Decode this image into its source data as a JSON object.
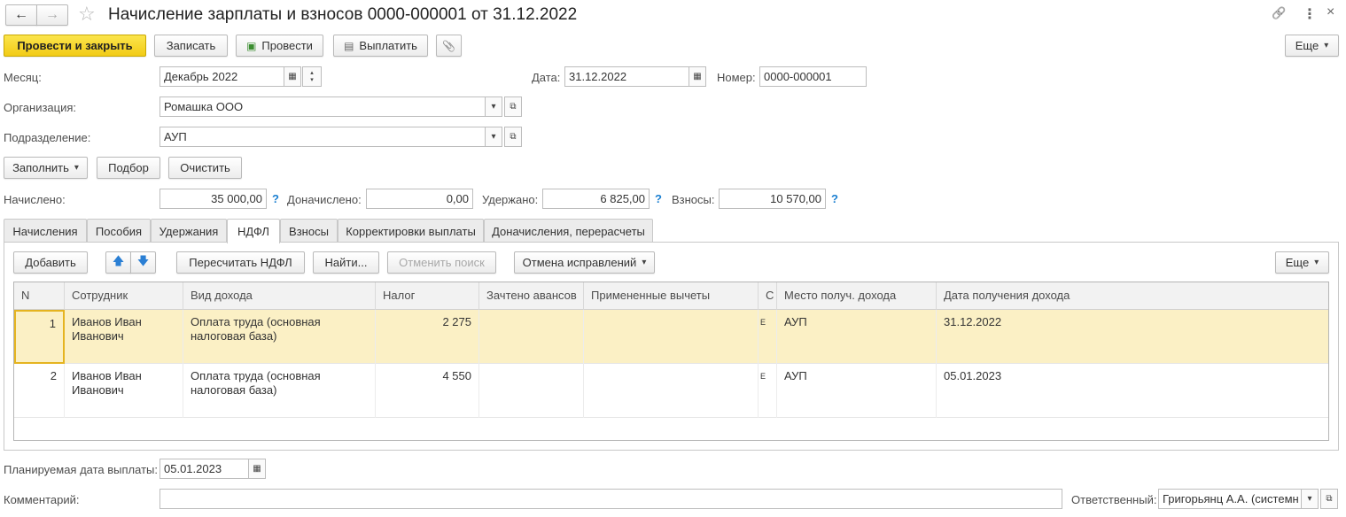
{
  "window": {
    "title": "Начисление зарплаты и взносов 0000-000001 от 31.12.2022",
    "nav_back": "←",
    "nav_forward": "→",
    "star": "☆",
    "link_icon": "🔗",
    "menu_icon": "⋮",
    "close_icon": "×"
  },
  "toolbar": {
    "post_close": "Провести и закрыть",
    "save": "Записать",
    "post": "Провести",
    "pay": "Выплатить",
    "attach_icon": "📎",
    "more": "Еще"
  },
  "header": {
    "month_label": "Месяц:",
    "month_value": "Декабрь 2022",
    "date_label": "Дата:",
    "date_value": "31.12.2022",
    "number_label": "Номер:",
    "number_value": "0000-000001",
    "org_label": "Организация:",
    "org_value": "Ромашка ООО",
    "dept_label": "Подразделение:",
    "dept_value": "АУП"
  },
  "actions": {
    "fill": "Заполнить",
    "pick": "Подбор",
    "clear": "Очистить"
  },
  "totals": {
    "accrued_label": "Начислено:",
    "accrued_value": "35 000,00",
    "additional_label": "Доначислено:",
    "additional_value": "0,00",
    "withheld_label": "Удержано:",
    "withheld_value": "6 825,00",
    "contributions_label": "Взносы:",
    "contributions_value": "10 570,00",
    "help_mark": "?"
  },
  "tabs": [
    {
      "label": "Начисления"
    },
    {
      "label": "Пособия"
    },
    {
      "label": "Удержания"
    },
    {
      "label": "НДФЛ"
    },
    {
      "label": "Взносы"
    },
    {
      "label": "Корректировки выплаты"
    },
    {
      "label": "Доначисления, перерасчеты"
    }
  ],
  "active_tab": "НДФЛ",
  "table_toolbar": {
    "add": "Добавить",
    "up_icon": "🡅",
    "down_icon": "🡇",
    "recalc": "Пересчитать НДФЛ",
    "find": "Найти...",
    "cancel_search": "Отменить поиск",
    "cancel_corrections": "Отмена исправлений",
    "more": "Еще"
  },
  "table": {
    "columns": [
      "N",
      "Сотрудник",
      "Вид дохода",
      "Налог",
      "Зачтено авансов",
      "Примененные вычеты",
      "С",
      "Место получ. дохода",
      "Дата получения дохода"
    ],
    "rows": [
      {
        "n": "1",
        "employee": "Иванов Иван Иванович",
        "income_type": "Оплата труда (основная налоговая база)",
        "tax": "2 275",
        "advances": "",
        "deductions": "",
        "c": "Е",
        "place": "АУП",
        "date": "31.12.2022"
      },
      {
        "n": "2",
        "employee": "Иванов Иван Иванович",
        "income_type": "Оплата труда (основная налоговая база)",
        "tax": "4 550",
        "advances": "",
        "deductions": "",
        "c": "Е",
        "place": "АУП",
        "date": "05.01.2023"
      }
    ]
  },
  "footer": {
    "pay_date_label": "Планируемая дата выплаты:",
    "pay_date_value": "05.01.2023",
    "comment_label": "Комментарий:",
    "comment_value": "",
    "responsible_label": "Ответственный:",
    "responsible_value": "Григорьянц А.А. (системн"
  }
}
